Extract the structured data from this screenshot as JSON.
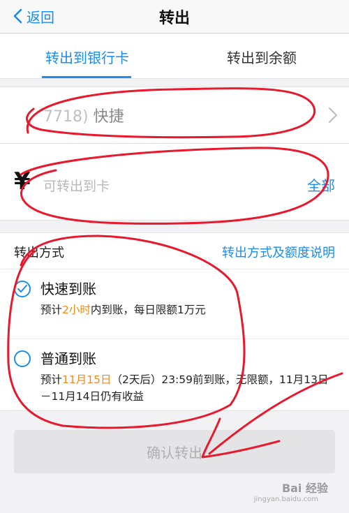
{
  "nav": {
    "back_label": "返回",
    "title": "转出"
  },
  "tabs": [
    {
      "label": "转出到银行卡",
      "active": true
    },
    {
      "label": "转出到余额",
      "active": false
    }
  ],
  "bank_card": {
    "text_obscured": "7718)",
    "text_tail": "快捷"
  },
  "amount": {
    "currency_symbol": "¥",
    "placeholder": "可转出到卡",
    "all_label": "全部"
  },
  "method": {
    "label": "转出方式",
    "info_link": "转出方式及额度说明",
    "options": [
      {
        "title": "快速到账",
        "selected": true,
        "desc_prefix": "预计",
        "desc_highlight": "2小时",
        "desc_suffix": "内到账，每日限额1万元"
      },
      {
        "title": "普通到账",
        "selected": false,
        "desc_prefix": "预计",
        "desc_highlight": "11月15日",
        "desc_suffix": "（2天后）23:59前到账，无限额，11月13日－11月14日仍有收益"
      }
    ]
  },
  "confirm_label": "确认转出",
  "watermark": {
    "text": "Bai 经验",
    "url": "jingyan.baidu.com"
  },
  "colors": {
    "accent": "#1a8df0",
    "highlight": "#f08a1c",
    "annotation": "#e8192c"
  }
}
